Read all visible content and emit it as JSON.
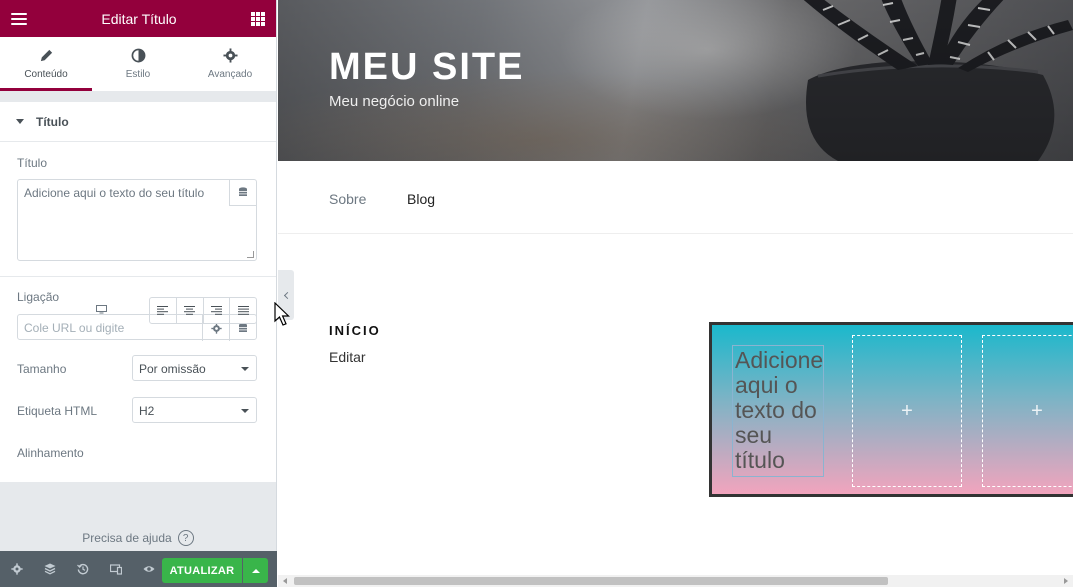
{
  "panel": {
    "header_title": "Editar Título",
    "tabs": [
      {
        "label": "Conteúdo",
        "icon": "pencil-icon",
        "active": true
      },
      {
        "label": "Estilo",
        "icon": "half-circle-icon",
        "active": false
      },
      {
        "label": "Avançado",
        "icon": "gear-icon",
        "active": false
      }
    ],
    "section_title": "Título",
    "controls": {
      "title_label": "Título",
      "title_value": "Adicione aqui o texto do seu título",
      "link_label": "Ligação",
      "link_placeholder": "Cole URL ou digite",
      "size_label": "Tamanho",
      "size_value": "Por omissão",
      "tag_label": "Etiqueta HTML",
      "tag_value": "H2",
      "align_label": "Alinhamento"
    },
    "help_text": "Precisa de ajuda",
    "help_icon": "?",
    "footer": {
      "update_label": "ATUALIZAR"
    }
  },
  "preview": {
    "site_title": "MEU SITE",
    "site_description": "Meu negócio online",
    "nav": [
      "Sobre",
      "Blog"
    ],
    "page_heading": "INÍCIO",
    "edit_link": "Editar",
    "widget_heading": "Adicione aqui o texto do seu título",
    "add_symbol": "+"
  },
  "colors": {
    "brand": "#93003c",
    "update": "#39b54a",
    "footer": "#556068"
  }
}
